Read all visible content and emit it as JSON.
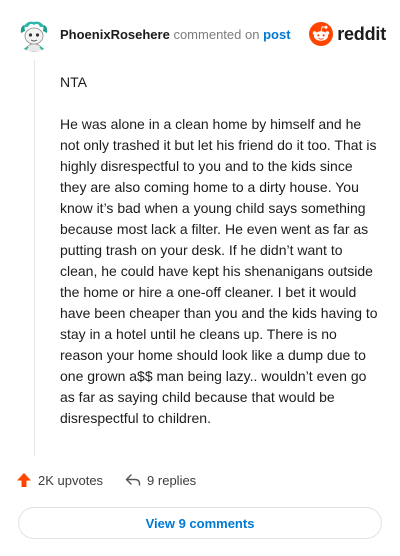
{
  "header": {
    "username": "PhoenixRosehere",
    "action_text": "commented on",
    "post_link": "post",
    "brand_name": "reddit"
  },
  "comment": {
    "paragraphs": [
      "NTA",
      "He was alone in a clean home by himself and he not only trashed it but let his friend do it too. That is highly disrespectful to you and to the kids since they are also coming home to a dirty house. You know it’s bad when a young child says something because most lack a filter. He even went as far as putting trash on your desk. If he didn’t want to clean, he could have kept his shenanigans outside the home or hire a one-off cleaner. I bet it would have been cheaper than you and the kids having to stay in a hotel until he cleans up. There is no reason your home should look like a dump due to one grown a$$ man being lazy.. wouldn’t even go as far as saying child because that would be disrespectful to children."
    ]
  },
  "actions": {
    "upvotes": "2K upvotes",
    "replies": "9 replies"
  },
  "footer": {
    "view_comments": "View 9 comments"
  },
  "icons": {
    "avatar": "avatar-icon",
    "brand": "reddit-logo-icon",
    "upvote": "upvote-arrow-icon",
    "reply": "reply-arrow-icon"
  },
  "colors": {
    "brand": "#ff4500",
    "link": "#0079d3",
    "avatar_accent": "#2bb6a8"
  }
}
